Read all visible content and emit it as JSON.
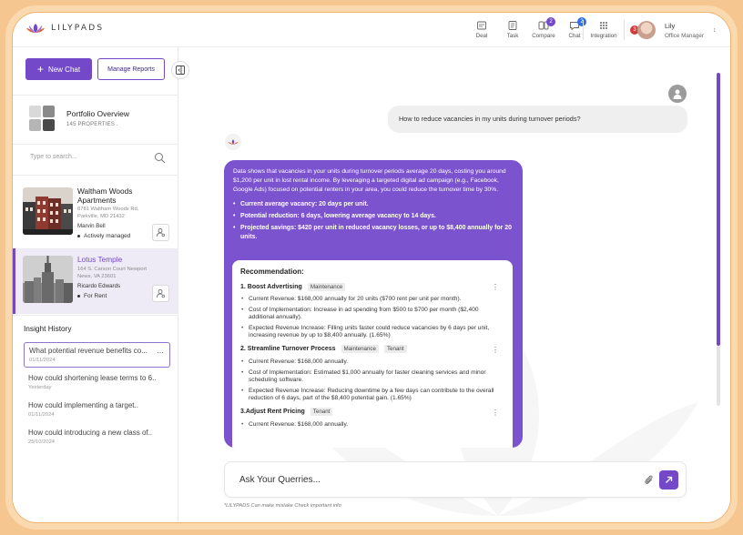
{
  "header": {
    "brand": "LILYPADS",
    "nav": [
      {
        "label": "Deal",
        "icon": "deal-icon",
        "badge": ""
      },
      {
        "label": "Task",
        "icon": "task-icon",
        "badge": ""
      },
      {
        "label": "Compare",
        "icon": "compare-icon",
        "badge": "2",
        "badge_color": "#7349c9"
      },
      {
        "label": "Chat",
        "icon": "chat-icon",
        "badge": "2",
        "badge_color": "#2f6fe0"
      },
      {
        "label": "Integration",
        "icon": "grid-icon",
        "badge": ""
      }
    ],
    "user": {
      "name": "Lily",
      "role": "Office Manager",
      "notifications": "3"
    }
  },
  "sidebar": {
    "new_chat": "New Chat",
    "manage_reports": "Manage Reports",
    "portfolio": {
      "title": "Portfolio Overview",
      "count": "145 PROPERTIES ."
    },
    "search_placeholder": "Type to search...",
    "properties": [
      {
        "name": "Waltham Woods Apartments",
        "address": "8781 Waltham Woods Rd, Parkville, MD 21432",
        "owner": "Marvin Bell",
        "status": "Actively managed"
      },
      {
        "name": "Lotus Temple",
        "address": "164 S. Carson Court Newport News, VA 23601",
        "owner": "Ricardo Edwards",
        "status": "For Rent"
      }
    ],
    "history_title": "Insight History",
    "history": [
      {
        "q": "What potential revenue benefits co...",
        "date": "01/11/2024"
      },
      {
        "q": "How could shortening lease terms to 6..",
        "date": "Yesterday"
      },
      {
        "q": "How could implementing a target..",
        "date": "01/11/2024"
      },
      {
        "q": "How could introducing a new class of..",
        "date": "25/10/2024"
      }
    ]
  },
  "chat": {
    "user_question": "How to reduce vacancies in my units during turnover periods?",
    "bot_intro": "Data shows that vacancies in your units during turnover periods average 20 days, costing you around $1,200 per unit in lost rental income. By leveraging a targeted digital ad campaign (e.g., Facebook, Google Ads) focused on potential renters in your area, you could reduce the turnover time by 30%.",
    "bot_points": [
      "Current average vacancy: 20 days per unit.",
      "Potential reduction: 6 days, lowering average vacancy to 14 days.",
      "Projected savings: $420 per unit in reduced vacancy losses, or up to $8,400 annually for 20 units."
    ],
    "recommendation": {
      "title": "Recommendation:",
      "items": [
        {
          "title": "1. Boost Advertising",
          "tags": [
            "Maintenance"
          ],
          "bullets": [
            "Current Revenue: $168,000 annually for 20 units ($700 rent per unit per month).",
            "Cost of Implementation: Increase in ad spending from $500 to $700 per month ($2,400 additional annually).",
            "Expected Revenue Increase: Filling units faster could reduce vacancies by 6 days per unit, increasing revenue by up to $8,400 annually. (1.65%)"
          ]
        },
        {
          "title": "2. Streamline Turnover Process",
          "tags": [
            "Maintenance",
            "Tenant"
          ],
          "bullets": [
            "Current Revenue: $168,000 annually.",
            "Cost of Implementation: Estimated $1,000 annually for faster cleaning services and minor scheduling software.",
            "Expected Revenue Increase: Reducing downtime by a few days can contribute to the overall reduction of 6 days, part of the $8,400 potential gain. (1.65%)"
          ]
        },
        {
          "title": "3.Adjust Rent Pricing",
          "tags": [
            "Tenant"
          ],
          "bullets": [
            "Current Revenue: $168,000 annually."
          ]
        }
      ]
    },
    "composer_placeholder": "Ask Your Querries...",
    "disclaimer": "*LILYPADS Can make mistake Check important info"
  },
  "colors": {
    "accent": "#7349c9",
    "bubble": "#7c53cf"
  }
}
